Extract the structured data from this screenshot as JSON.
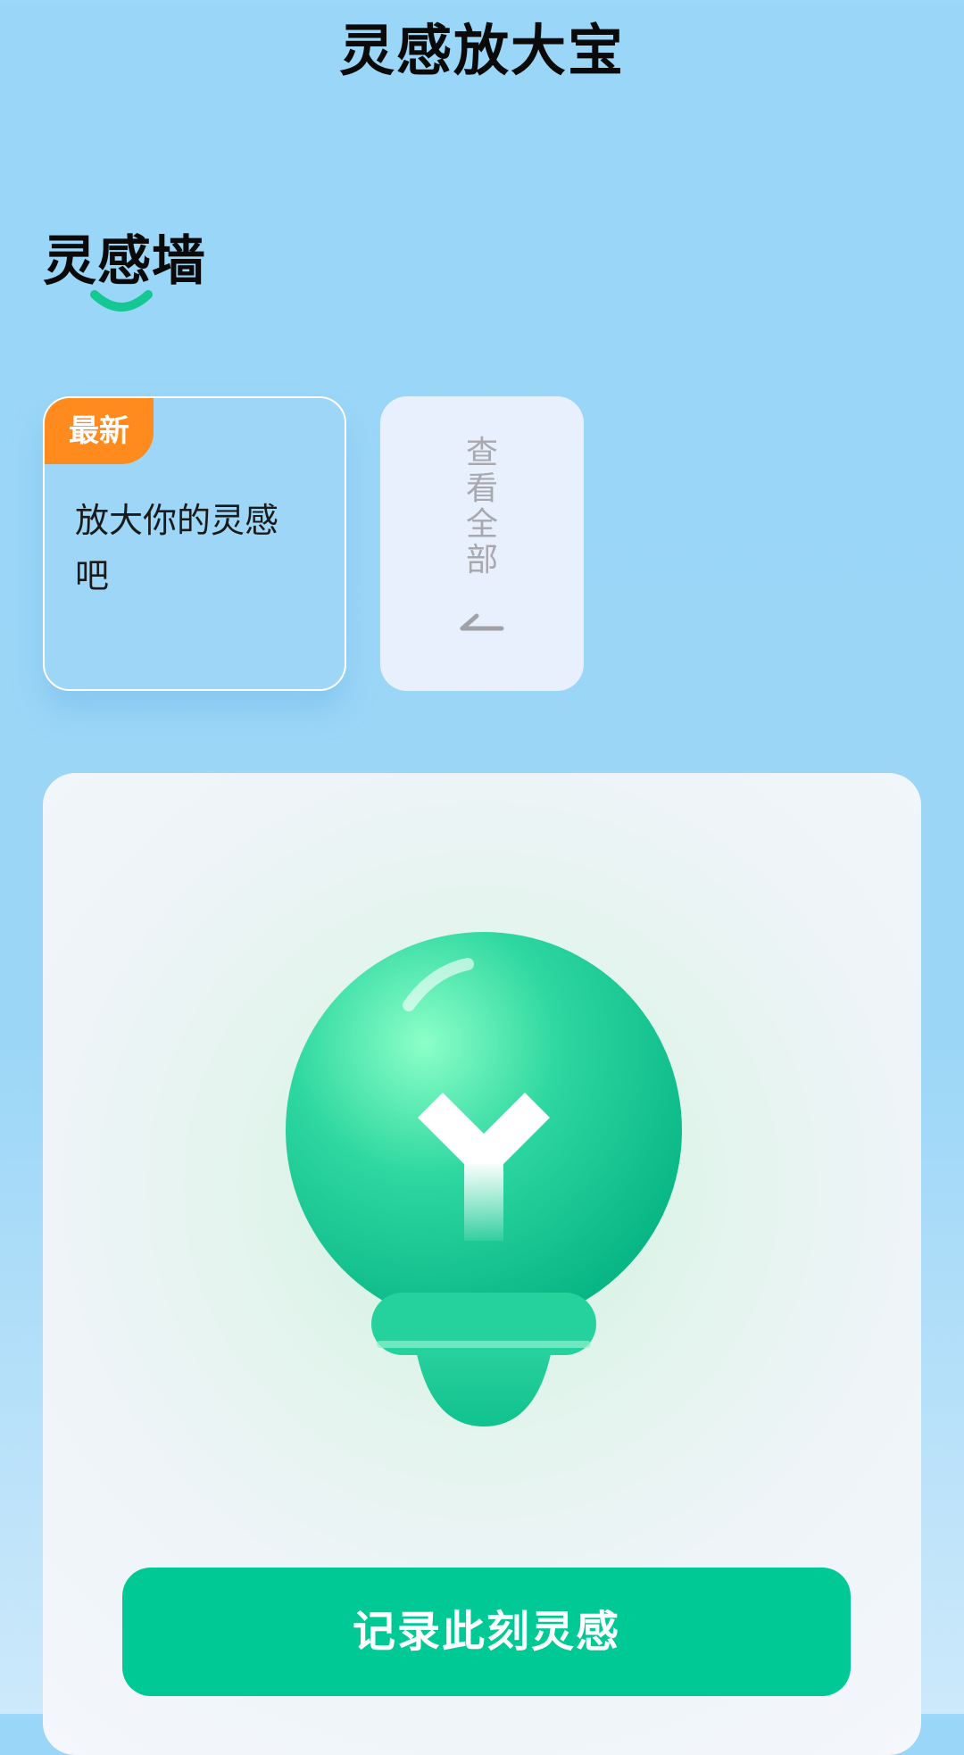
{
  "header": {
    "title": "灵感放大宝"
  },
  "wall": {
    "title": "灵感墙"
  },
  "cards": {
    "latest": {
      "badge": "最新",
      "text": "放大你的灵感吧"
    },
    "view_all": {
      "chars": [
        "查",
        "看",
        "全",
        "部"
      ]
    }
  },
  "icons": {
    "smile": "smile-icon",
    "arrow": "arrow-left-icon",
    "bulb": "lightbulb-icon"
  },
  "colors": {
    "accent": "#00c996",
    "badge": "#ff8a1d",
    "background": "#9ad6f7"
  },
  "actions": {
    "record_label": "记录此刻灵感"
  }
}
